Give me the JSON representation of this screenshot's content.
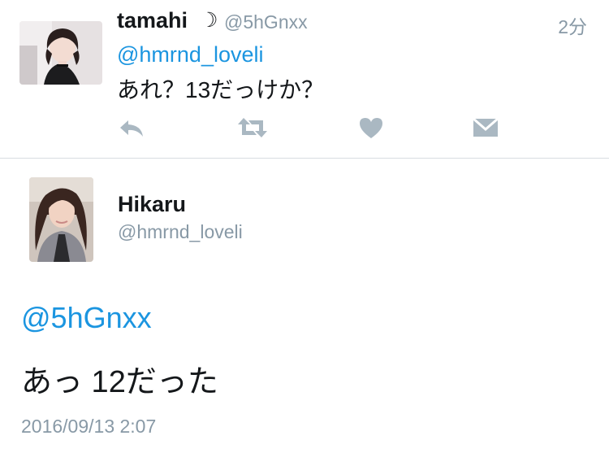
{
  "reply_tweet": {
    "display_name": "tamahi",
    "name_emoji": "☽",
    "handle": "@5hGnxx",
    "time": "2分",
    "mention": "@hmrnd_loveli",
    "text": "あれ？13だっけか？",
    "actions": [
      {
        "name": "reply",
        "icon": "reply-icon"
      },
      {
        "name": "retweet",
        "icon": "retweet-icon"
      },
      {
        "name": "like",
        "icon": "heart-icon"
      },
      {
        "name": "direct-message",
        "icon": "envelope-icon"
      }
    ]
  },
  "main_tweet": {
    "display_name": "Hikaru",
    "handle": "@hmrnd_loveli",
    "mention": "@5hGnxx",
    "text": "あっ 12だった",
    "timestamp": "2016/09/13 2:07"
  },
  "colors": {
    "link": "#1b95e0",
    "secondary_text": "#8899a6",
    "action_icon": "#aab8c2",
    "divider": "#d8dde1"
  }
}
